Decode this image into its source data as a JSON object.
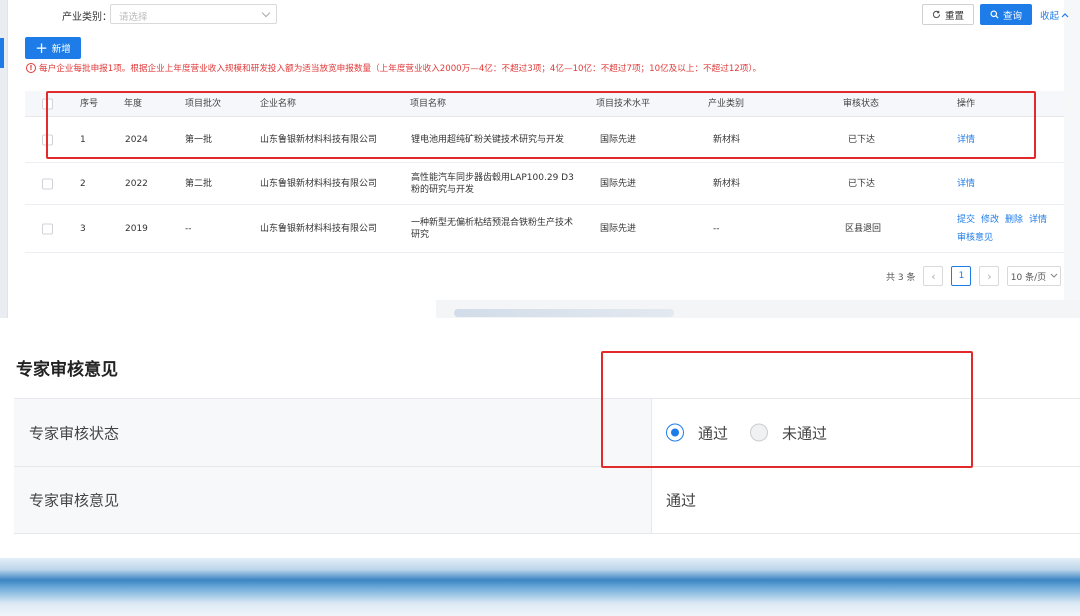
{
  "filter": {
    "category_label": "产业类别：",
    "category_placeholder": "请选择",
    "reset_label": "重置",
    "query_label": "查询",
    "collapse_label": "收起"
  },
  "toolbar": {
    "add_label": "新增"
  },
  "notice": "每户企业每批申报1项。根据企业上年度营业收入规模和研发投入额为适当放宽申报数量（上年度营业收入2000万—4亿：不超过3项；4亿—10亿：不超过7项；10亿及以上：不超过12项）。",
  "table": {
    "headers": {
      "index": "序号",
      "year": "年度",
      "batch": "项目批次",
      "company": "企业名称",
      "project": "项目名称",
      "tech_level": "项目技术水平",
      "category": "产业类别",
      "status": "审核状态",
      "ops": "操作"
    },
    "rows": [
      {
        "index": "1",
        "year": "2024",
        "batch": "第一批",
        "company": "山东鲁银新材料科技有限公司",
        "project": "锂电池用超纯矿粉关键技术研究与开发",
        "tech_level": "国际先进",
        "category": "新材料",
        "status": "已下达",
        "ops": [
          "详情"
        ]
      },
      {
        "index": "2",
        "year": "2022",
        "batch": "第二批",
        "company": "山东鲁银新材料科技有限公司",
        "project": "高性能汽车同步器齿毂用LAP100.29 D3粉的研究与开发",
        "tech_level": "国际先进",
        "category": "新材料",
        "status": "已下达",
        "ops": [
          "详情"
        ]
      },
      {
        "index": "3",
        "year": "2019",
        "batch": "--",
        "company": "山东鲁银新材料科技有限公司",
        "project": "一种新型无偏析粘结预混合铁粉生产技术研究",
        "tech_level": "国际先进",
        "category": "--",
        "status": "区县退回",
        "ops": [
          "提交",
          "修改",
          "删除",
          "详情",
          "审核意见"
        ]
      }
    ]
  },
  "pagination": {
    "total_label": "共 3 条",
    "current_page": "1",
    "page_size_label": "10 条/页"
  },
  "review": {
    "section_title": "专家审核意见",
    "status_label": "专家审核状态",
    "status_options": [
      "通过",
      "未通过"
    ],
    "status_selected": "通过",
    "opinion_label": "专家审核意见",
    "opinion_value": "通过"
  },
  "colors": {
    "primary": "#1e7ce8",
    "notice_red": "#e03a3a",
    "highlight_red": "#e22a2a"
  }
}
